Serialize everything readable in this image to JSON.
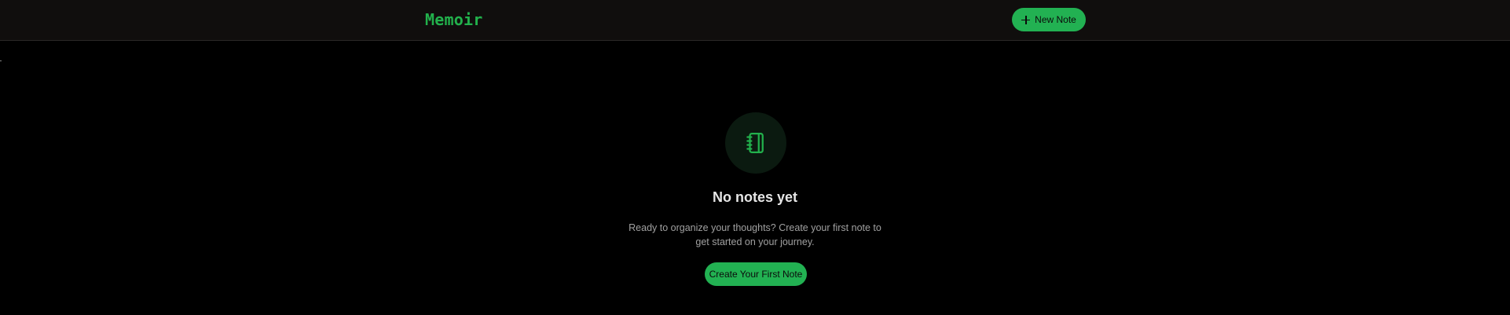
{
  "header": {
    "brand": "Memoir",
    "new_note_label": "New Note",
    "new_note_icon": "plus-icon"
  },
  "empty_state": {
    "icon": "notebook-icon",
    "title": "No notes yet",
    "description": "Ready to organize your thoughts? Create your first note to get started on your journey.",
    "cta_label": "Create Your First Note"
  },
  "colors": {
    "accent": "#22b152",
    "background": "#000000",
    "topbar": "#100e0d"
  }
}
